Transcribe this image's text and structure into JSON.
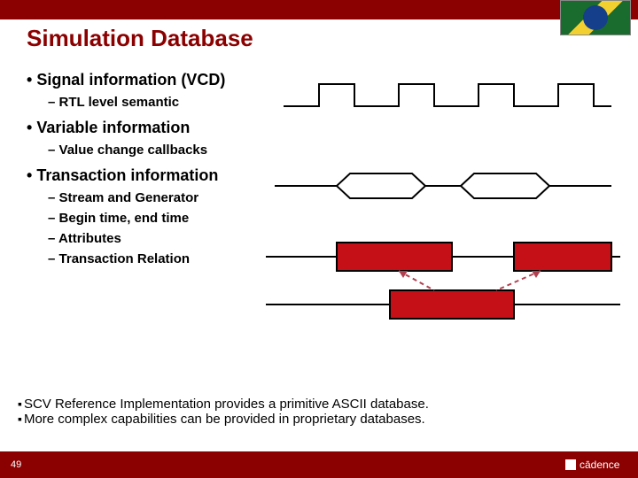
{
  "title": "Simulation Database",
  "bullets": {
    "signal": "Signal information (VCD)",
    "signal_sub": "RTL level semantic",
    "variable": "Variable information",
    "variable_sub": "Value change callbacks",
    "transaction": "Transaction information",
    "tx_sub1": "Stream and Generator",
    "tx_sub2": "Begin time, end time",
    "tx_sub3": "Attributes",
    "tx_sub4": "Transaction Relation"
  },
  "footer": {
    "line1": "SCV Reference Implementation provides a primitive ASCII database.",
    "line2": "More complex capabilities can be provided in proprietary databases."
  },
  "page_number": "49",
  "logo_text": "cādence"
}
